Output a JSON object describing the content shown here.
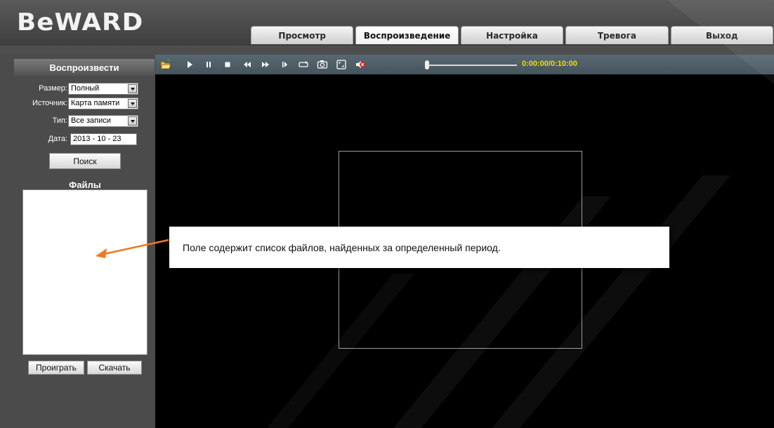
{
  "header": {
    "logo": "BeWARD",
    "tabs": [
      {
        "label": "Просмотр"
      },
      {
        "label": "Воспроизведение"
      },
      {
        "label": "Настройка"
      },
      {
        "label": "Тревога"
      },
      {
        "label": "Выход"
      }
    ],
    "active_tab": "Воспроизведение"
  },
  "sidebar": {
    "title": "Воспроизвести",
    "size": {
      "label": "Размер:",
      "value": "Полный"
    },
    "source": {
      "label": "Источник:",
      "value": "Карта памяти"
    },
    "type": {
      "label": "Тип:",
      "value": "Все записи"
    },
    "date": {
      "label": "Дата:",
      "value": "2013 -  10 -  23"
    },
    "search_label": "Поиск",
    "files_label": "Файлы",
    "play_label": "Проиграть",
    "download_label": "Скачать"
  },
  "player": {
    "time": "0:00:00/0:10:00",
    "progress": 0,
    "icons": [
      "open-folder-icon",
      "play-icon",
      "pause-icon",
      "stop-icon",
      "rewind-icon",
      "fast-forward-icon",
      "step-forward-icon",
      "loop-icon",
      "snapshot-icon",
      "fullscreen-icon",
      "mute-icon"
    ]
  },
  "callout": {
    "text": "Поле содержит список файлов, найденных за определенный период."
  },
  "colors": {
    "time": "#e8e000",
    "arrow": "#f07820",
    "background": "#4e4e4e"
  }
}
